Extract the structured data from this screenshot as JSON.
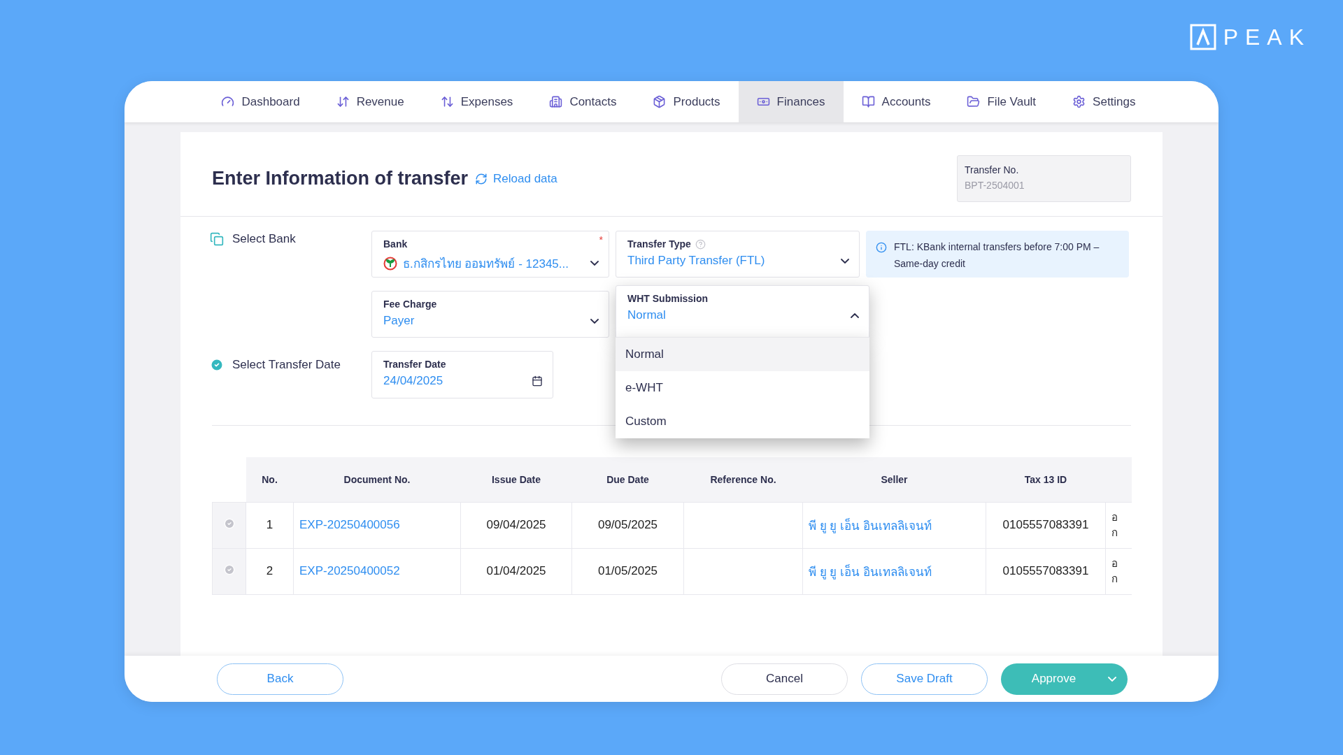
{
  "logo": {
    "text": "PEAK"
  },
  "nav": [
    {
      "label": "Dashboard",
      "selected": false
    },
    {
      "label": "Revenue",
      "selected": false
    },
    {
      "label": "Expenses",
      "selected": false
    },
    {
      "label": "Contacts",
      "selected": false
    },
    {
      "label": "Products",
      "selected": false
    },
    {
      "label": "Finances",
      "selected": true
    },
    {
      "label": "Accounts",
      "selected": false
    },
    {
      "label": "File Vault",
      "selected": false
    },
    {
      "label": "Settings",
      "selected": false
    }
  ],
  "header": {
    "title": "Enter Information of transfer",
    "reload": "Reload data",
    "transfer_no": {
      "label": "Transfer No.",
      "value": "BPT-2504001"
    }
  },
  "steps": [
    {
      "label": "Select Bank",
      "kind": "bank"
    },
    {
      "label": "Select Transfer Date",
      "kind": "date"
    }
  ],
  "bank": {
    "label": "Bank",
    "value": "ธ.กสิกรไทย ออมทรัพย์ - 12345...",
    "required_mark": "*"
  },
  "transfer_type": {
    "label": "Transfer Type",
    "value": "Third Party Transfer (FTL)"
  },
  "info_note": "FTL: KBank internal transfers before 7:00 PM – Same-day credit",
  "fee_charge": {
    "label": "Fee Charge",
    "value": "Payer"
  },
  "wht_submission": {
    "label": "WHT Submission",
    "value": "Normal",
    "expanded": true,
    "options": [
      {
        "label": "Normal",
        "selected": true
      },
      {
        "label": "e-WHT",
        "selected": false
      },
      {
        "label": "Custom",
        "selected": false
      }
    ]
  },
  "transfer_date": {
    "label": "Transfer Date",
    "value": "24/04/2025"
  },
  "table": {
    "columns": [
      "No.",
      "Document No.",
      "Issue Date",
      "Due Date",
      "Reference No.",
      "Seller",
      "Tax 13 ID"
    ],
    "rows": [
      {
        "no": "1",
        "document_no": "EXP-20250400056",
        "issue_date": "09/04/2025",
        "due_date": "09/05/2025",
        "reference_no": "",
        "seller": "พี ยู ยู เอ็น อินเทลลิเจนท์",
        "tax_id": "0105557083391",
        "column_8": "อ ก"
      },
      {
        "no": "2",
        "document_no": "EXP-20250400052",
        "issue_date": "01/04/2025",
        "due_date": "01/05/2025",
        "reference_no": "",
        "seller": "พี ยู ยู เอ็น อินเทลลิเจนท์",
        "tax_id": "0105557083391",
        "column_8": "อ ก"
      }
    ]
  },
  "footer": {
    "back": "Back",
    "cancel": "Cancel",
    "save_draft": "Save Draft",
    "approve": "Approve"
  }
}
